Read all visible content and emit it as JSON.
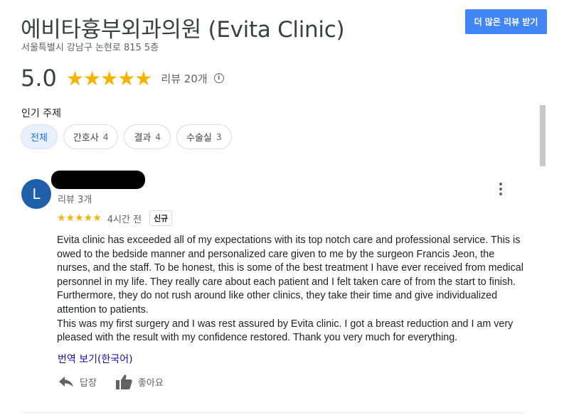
{
  "header": {
    "title": "에비타흉부외과의원 (Evita Clinic)",
    "address": "서울특별시 강남구 논현로 815 5층",
    "more_reviews_label": "더 많은 리뷰 받기"
  },
  "summary": {
    "rating": "5.0",
    "stars": "★★★★★",
    "review_count": "리뷰 20개",
    "info_glyph": "i"
  },
  "topics": {
    "label": "인기 주제",
    "chips": [
      {
        "label": "전체",
        "count": ""
      },
      {
        "label": "간호사",
        "count": "4"
      },
      {
        "label": "결과",
        "count": "4"
      },
      {
        "label": "수술실",
        "count": "3"
      }
    ]
  },
  "review": {
    "avatar_letter": "L",
    "reviewer_reviews": "리뷰 3개",
    "stars": "★★★★★",
    "time": "4시간 전",
    "badge": "신규",
    "paragraphs": [
      "Evita clinic has exceeded all of my expectations with its top notch care and professional service. This is owed to the bedside manner and personalized care given to me by  the surgeon Francis Jeon, the nurses, and the staff.  To be honest, this is some of the best treatment I have ever received from medical personnel in my life.  They really care about each patient and I felt taken care of from the start to finish. Furthermore,  they do not rush around like other clinics, they take their time and give individualized attention to patients.",
      "This was my first surgery and I was rest assured by Evita clinic. I got a breast reduction and I am very pleased with the result with my confidence restored. Thank you very much for everything."
    ],
    "translate_label": "번역 보기(한국어)",
    "reply_label": "답장",
    "like_label": "좋아요"
  },
  "colors": {
    "accent": "#4285f4",
    "star": "#f6b400",
    "avatar": "#1f5fa9",
    "link": "#1a0dab"
  }
}
